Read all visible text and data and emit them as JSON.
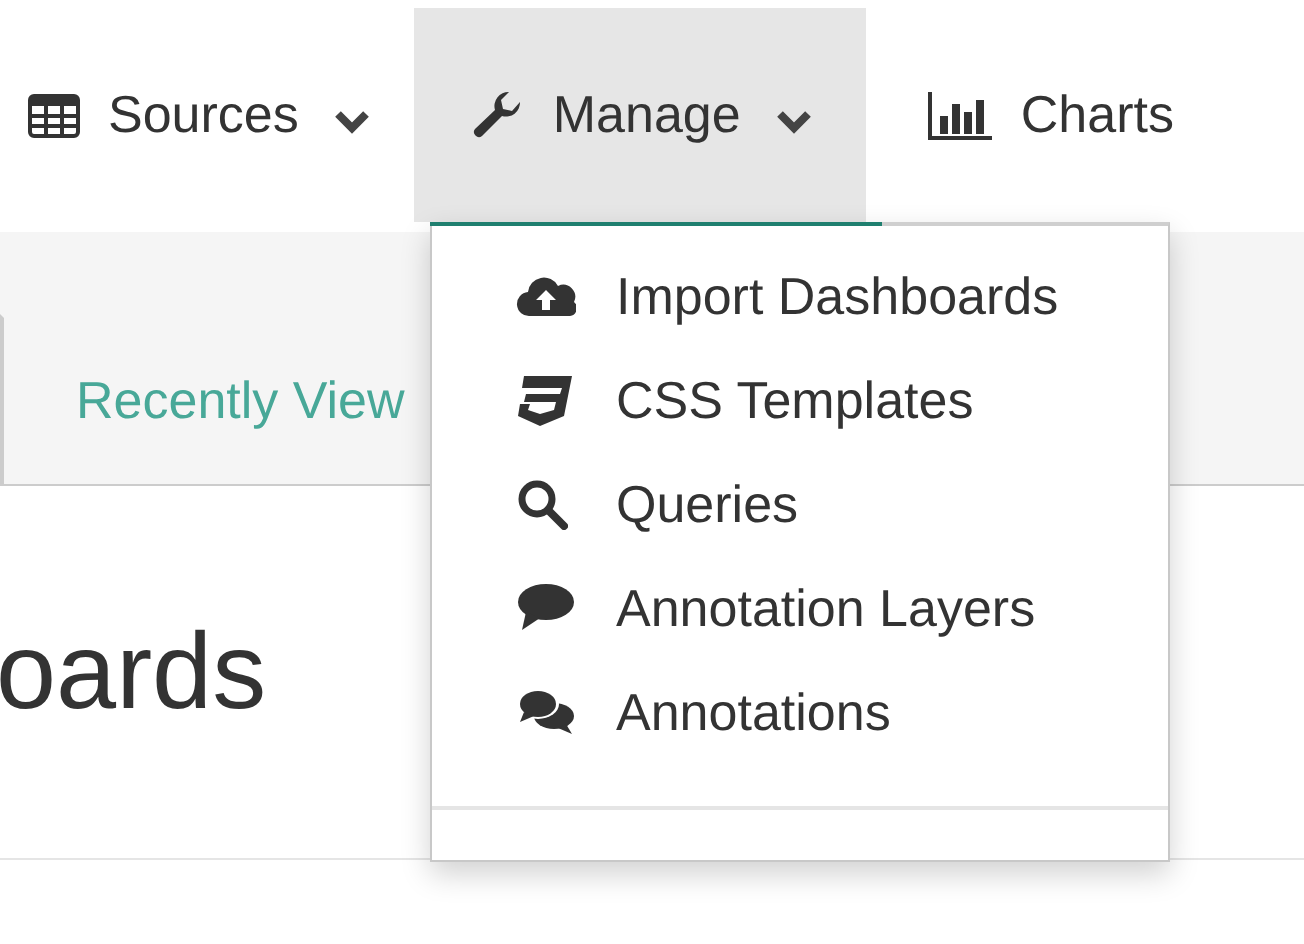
{
  "nav": [
    {
      "label": "Sources",
      "dropdown": true,
      "selected": false
    },
    {
      "label": "Manage",
      "dropdown": true,
      "selected": true
    },
    {
      "label": "Charts",
      "dropdown": false,
      "selected": false
    }
  ],
  "manage_menu": {
    "items": [
      {
        "label": "Import Dashboards"
      },
      {
        "label": "CSS Templates"
      },
      {
        "label": "Queries"
      },
      {
        "label": "Annotation Layers"
      },
      {
        "label": "Annotations"
      }
    ]
  },
  "tabs": [
    {
      "label": "Recently View",
      "selected": true
    }
  ],
  "heading": "oards"
}
